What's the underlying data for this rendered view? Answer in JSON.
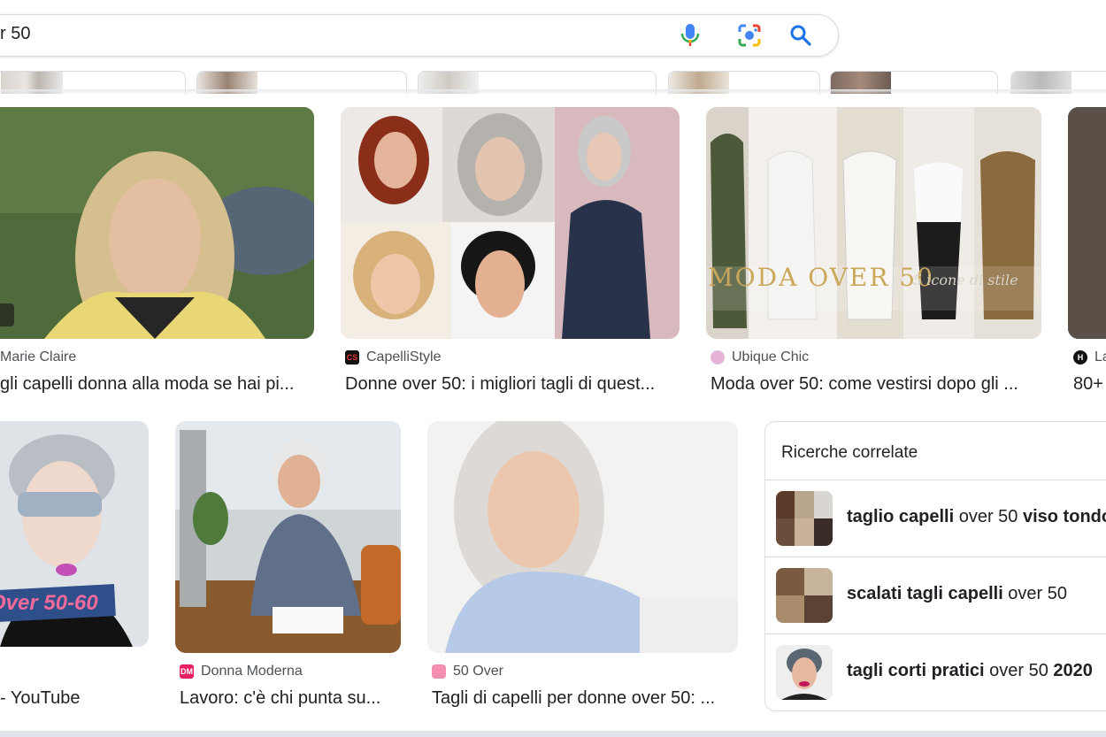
{
  "search": {
    "query": "r 50"
  },
  "results_row1": [
    {
      "source": "Marie Claire",
      "title": "gli capelli donna alla moda se hai pi..."
    },
    {
      "source": "CapelliStyle",
      "title": "Donne over 50: i migliori tagli di quest..."
    },
    {
      "source": "Ubique Chic",
      "title": "Moda over 50: come vestirsi dopo gli ..."
    },
    {
      "source": "La",
      "title": "80+"
    }
  ],
  "results_row2": [
    {
      "source": "",
      "title": "- YouTube",
      "overlay": "Over 50-60"
    },
    {
      "source": "Donna Moderna",
      "title": "Lavoro: c'è chi punta su..."
    },
    {
      "source": "50 Over",
      "title": "Tagli di capelli per donne over 50: ..."
    }
  ],
  "image_overlays": {
    "moda_text": "MODA OVER 50",
    "moda_script": "5 icone di stile"
  },
  "favicons": {
    "capellistyle": "CS",
    "donna_moderna": "DM"
  },
  "related": {
    "heading": "Ricerche correlate",
    "items": [
      {
        "bold1": "taglio capelli",
        "normal": " over 50 ",
        "bold2": "viso tondo"
      },
      {
        "bold1": "scalati tagli capelli",
        "normal": " over 50",
        "bold2": ""
      },
      {
        "bold1": "tagli corti pratici",
        "normal": " over 50 ",
        "bold2": "2020"
      }
    ]
  },
  "colors": {
    "mic_blue": "#4285f4",
    "mic_red": "#ea4335",
    "search_blue": "#1a73e8"
  }
}
